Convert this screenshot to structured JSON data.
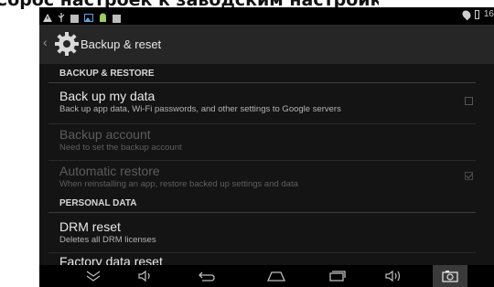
{
  "caption": "Сброс настроек к заводским настройкам",
  "statusbar": {
    "left_icons": [
      "warning-icon",
      "usb-icon",
      "screenshot-icon",
      "image-icon",
      "android-icon",
      "sd-icon"
    ],
    "time": "16"
  },
  "actionbar": {
    "title": "Backup & reset"
  },
  "sections": {
    "backup_restore": "BACKUP & RESTORE",
    "personal_data": "PERSONAL DATA"
  },
  "items": {
    "backup_data": {
      "title": "Back up my data",
      "subtitle": "Back up app data, Wi-Fi passwords, and other settings to Google servers",
      "checked": false
    },
    "backup_account": {
      "title": "Backup account",
      "subtitle": "Need to set the backup account"
    },
    "auto_restore": {
      "title": "Automatic restore",
      "subtitle": "When reinstalling an app, restore backed up settings and data",
      "checked": true
    },
    "drm_reset": {
      "title": "DRM reset",
      "subtitle": "Deletes all DRM licenses"
    },
    "factory_reset": {
      "title": "Factory data reset"
    }
  },
  "navbar": [
    "hide-keyboard-icon",
    "volume-down-icon",
    "back-icon",
    "home-icon",
    "recents-icon",
    "volume-up-icon",
    "camera-icon"
  ],
  "colors": {
    "background": "#141414",
    "actionbar": "#262626",
    "text_primary": "#e9e9e9",
    "text_secondary": "#b3b3b3",
    "text_disabled": "#5c5c5c"
  }
}
